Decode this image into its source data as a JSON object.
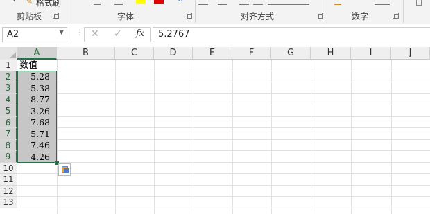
{
  "ribbon": {
    "clipboard_label": "剪贴板",
    "format_painter_label": "格式刷",
    "font_label": "字体",
    "alignment_label": "对齐方式",
    "number_label": "数字"
  },
  "formula_bar": {
    "name_box": "A2",
    "formula_value": "5.2767",
    "fx_label": "fx"
  },
  "columns": [
    "A",
    "B",
    "C",
    "D",
    "E",
    "F",
    "G",
    "H",
    "I",
    "J"
  ],
  "rows": [
    "1",
    "2",
    "3",
    "4",
    "5",
    "6",
    "7",
    "8",
    "9",
    "10",
    "11",
    "12",
    "13"
  ],
  "cells": {
    "A1": "数值",
    "values": [
      "5.28",
      "5.38",
      "8.77",
      "3.26",
      "7.68",
      "5.71",
      "7.46",
      "4.26"
    ]
  },
  "colors": {
    "accent": "#217346",
    "selection_fill": "#c6c6c6"
  }
}
